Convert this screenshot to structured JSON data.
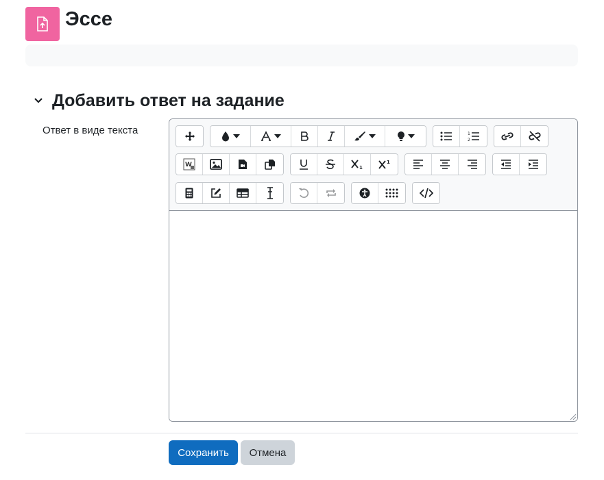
{
  "header": {
    "title": "Эссе",
    "icon": "assignment-upload-icon",
    "icon_color": "#f064a0"
  },
  "section": {
    "title": "Добавить ответ на задание",
    "expanded": true
  },
  "field": {
    "label": "Ответ в виде текста",
    "value": ""
  },
  "toolbar": {
    "rows": [
      [
        [
          "move-icon"
        ],
        [
          "font-color-icon",
          "font-family-icon",
          "bold-icon",
          "italic-icon",
          "style-brush-icon",
          "lightbulb-icon"
        ],
        [
          "unordered-list-icon",
          "ordered-list-icon"
        ],
        [
          "link-icon",
          "unlink-icon"
        ]
      ],
      [
        [
          "word-import-icon",
          "image-icon",
          "media-file-icon",
          "copy-file-icon"
        ],
        [
          "underline-icon",
          "strikethrough-icon",
          "subscript-icon",
          "superscript-icon"
        ],
        [
          "align-left-icon",
          "align-center-icon",
          "align-right-icon"
        ],
        [
          "outdent-icon",
          "indent-icon"
        ]
      ],
      [
        [
          "calculator-icon",
          "edit-icon",
          "table-icon",
          "clear-formatting-icon"
        ],
        [
          "undo-icon",
          "redo-icon"
        ],
        [
          "accessibility-icon",
          "special-characters-icon"
        ],
        [
          "html-code-icon"
        ]
      ]
    ]
  },
  "buttons": {
    "save": "Сохранить",
    "cancel": "Отмена"
  },
  "colors": {
    "primary": "#0f6cbf",
    "secondary": "#ced4da",
    "icon": "#1d2125"
  }
}
